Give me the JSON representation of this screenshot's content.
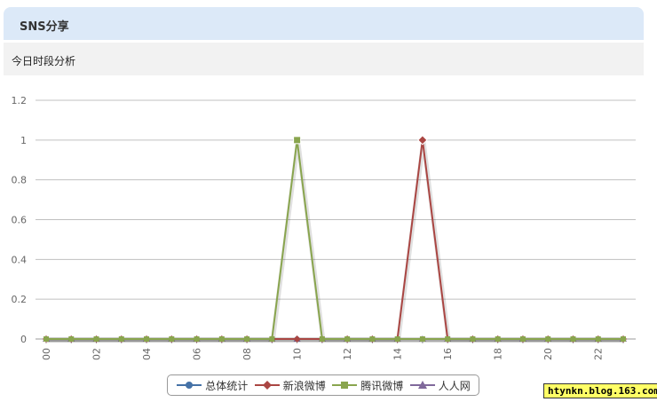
{
  "panel": {
    "title": "SNS分享"
  },
  "section": {
    "title": "今日时段分析"
  },
  "watermark": "htynkn.blog.163.com",
  "chart_data": {
    "type": "line",
    "title": "",
    "xlabel": "",
    "ylabel": "",
    "x": [
      "00",
      "01",
      "02",
      "03",
      "04",
      "05",
      "06",
      "07",
      "08",
      "09",
      "10",
      "11",
      "12",
      "13",
      "14",
      "15",
      "16",
      "17",
      "18",
      "19",
      "20",
      "21",
      "22",
      "23"
    ],
    "x_tick_labels": [
      "00",
      "02",
      "04",
      "06",
      "08",
      "10",
      "12",
      "14",
      "16",
      "18",
      "20",
      "22"
    ],
    "y_ticks": [
      "0",
      "0.2",
      "0.4",
      "0.6",
      "0.8",
      "1",
      "1.2"
    ],
    "ylim": [
      0,
      1.2
    ],
    "grid": true,
    "legend_position": "bottom",
    "series": [
      {
        "name": "总体统计",
        "color": "#4572a7",
        "marker": "circle",
        "values": [
          0,
          0,
          0,
          0,
          0,
          0,
          0,
          0,
          0,
          0,
          0,
          0,
          0,
          0,
          0,
          0,
          0,
          0,
          0,
          0,
          0,
          0,
          0,
          0
        ]
      },
      {
        "name": "新浪微博",
        "color": "#aa4643",
        "marker": "diamond",
        "values": [
          0,
          0,
          0,
          0,
          0,
          0,
          0,
          0,
          0,
          0,
          0,
          0,
          0,
          0,
          0,
          1,
          0,
          0,
          0,
          0,
          0,
          0,
          0,
          0
        ]
      },
      {
        "name": "腾讯微博",
        "color": "#89a54e",
        "marker": "square",
        "values": [
          0,
          0,
          0,
          0,
          0,
          0,
          0,
          0,
          0,
          0,
          1,
          0,
          0,
          0,
          0,
          0,
          0,
          0,
          0,
          0,
          0,
          0,
          0,
          0
        ]
      },
      {
        "name": "人人网",
        "color": "#80699b",
        "marker": "triangle",
        "values": [
          0,
          0,
          0,
          0,
          0,
          0,
          0,
          0,
          0,
          0,
          0,
          0,
          0,
          0,
          0,
          0,
          0,
          0,
          0,
          0,
          0,
          0,
          0,
          0
        ]
      }
    ]
  }
}
